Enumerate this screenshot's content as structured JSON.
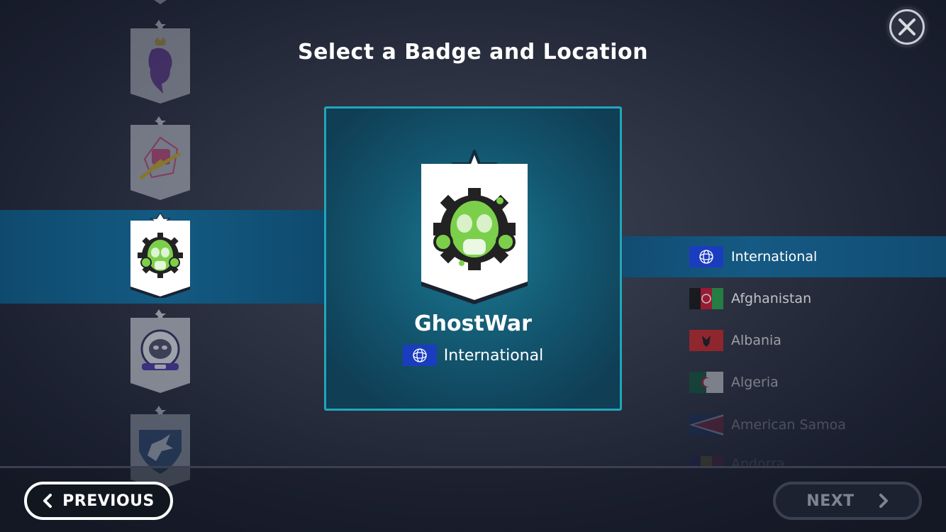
{
  "title": "Select a Badge and Location",
  "close_icon": "close-icon",
  "selected": {
    "name": "GhostWar",
    "location": "International"
  },
  "badges": [
    {
      "icon": "lion-badge-icon"
    },
    {
      "icon": "fist-badge-icon"
    },
    {
      "icon": "gasmask-gear-badge-icon",
      "selected": true
    },
    {
      "icon": "astronaut-monkey-badge-icon"
    },
    {
      "icon": "pegasus-badge-icon"
    }
  ],
  "countries": [
    {
      "name": "International",
      "selected": true
    },
    {
      "name": "Afghanistan"
    },
    {
      "name": "Albania"
    },
    {
      "name": "Algeria"
    },
    {
      "name": "American Samoa"
    },
    {
      "name": "Andorra"
    }
  ],
  "buttons": {
    "previous": "PREVIOUS",
    "next": "NEXT"
  },
  "colors": {
    "accent": "#1fa7bb",
    "selection_band": "#135a82",
    "badge_green": "#7ccf4b"
  }
}
